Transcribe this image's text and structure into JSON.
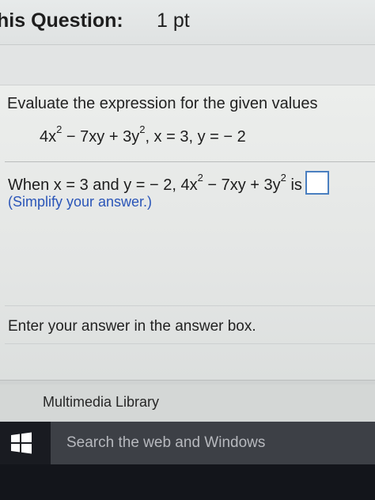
{
  "header": {
    "title": "his Question:",
    "points": "1 pt"
  },
  "question": {
    "prompt": "Evaluate the expression for the given values",
    "expression": {
      "t1": "4x",
      "t1_exp": "2",
      "t2": " − 7xy + 3y",
      "t2_exp": "2",
      "values": ", x = 3, y = − 2"
    },
    "answer_line": {
      "prefix": "When x = 3 and y = − 2, 4x",
      "exp1": "2",
      "mid": " − 7xy + 3y",
      "exp2": "2",
      "suffix": " is"
    },
    "hint": "(Simplify your answer.)",
    "instruction": "Enter your answer in the answer box.",
    "answer_value": ""
  },
  "footer": {
    "media_library": "Multimedia Library"
  },
  "taskbar": {
    "start_icon": "windows-logo-icon",
    "search_placeholder": "Search the web and Windows"
  }
}
